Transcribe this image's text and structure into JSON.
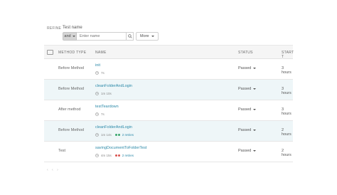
{
  "refine": {
    "label": "REFINE",
    "test_name_label": "Test name"
  },
  "filter": {
    "operator": "and",
    "name_placeholder": "Enter name",
    "more_label": "More"
  },
  "table": {
    "headers": {
      "method_type": "METHOD TYPE",
      "name": "NAME",
      "status": "STATUS",
      "start": "START T"
    },
    "rows": [
      {
        "method_type": "Before Method",
        "name": "init",
        "duration": "7s",
        "retries": "",
        "status": "Passed",
        "start": "3 hours"
      },
      {
        "method_type": "Before Method",
        "name": "cleanFolderAndLogin",
        "duration": "1m 10s",
        "retries": "",
        "status": "Passed",
        "start": "3 hours"
      },
      {
        "method_type": "After method",
        "name": "testTeardown",
        "duration": "7s",
        "retries": "",
        "status": "Passed",
        "start": "3 hours"
      },
      {
        "method_type": "Before Method",
        "name": "cleanFolderAndLogin",
        "duration": "1m 14s",
        "retries": "2 retries",
        "status": "Passed",
        "start": "2 hours"
      },
      {
        "method_type": "Test",
        "name": "savingDocumentToFolderTest",
        "duration": "4m 15s",
        "retries": "2 retries",
        "status": "Passed",
        "start": "2 hours"
      }
    ]
  },
  "colors": {
    "link": "#2b89a8",
    "dot_green": "#3aa76d",
    "dot_red": "#d9534f",
    "row_alt": "#eef6f8"
  },
  "footer": {
    "text": "‹ ‹ ›"
  }
}
